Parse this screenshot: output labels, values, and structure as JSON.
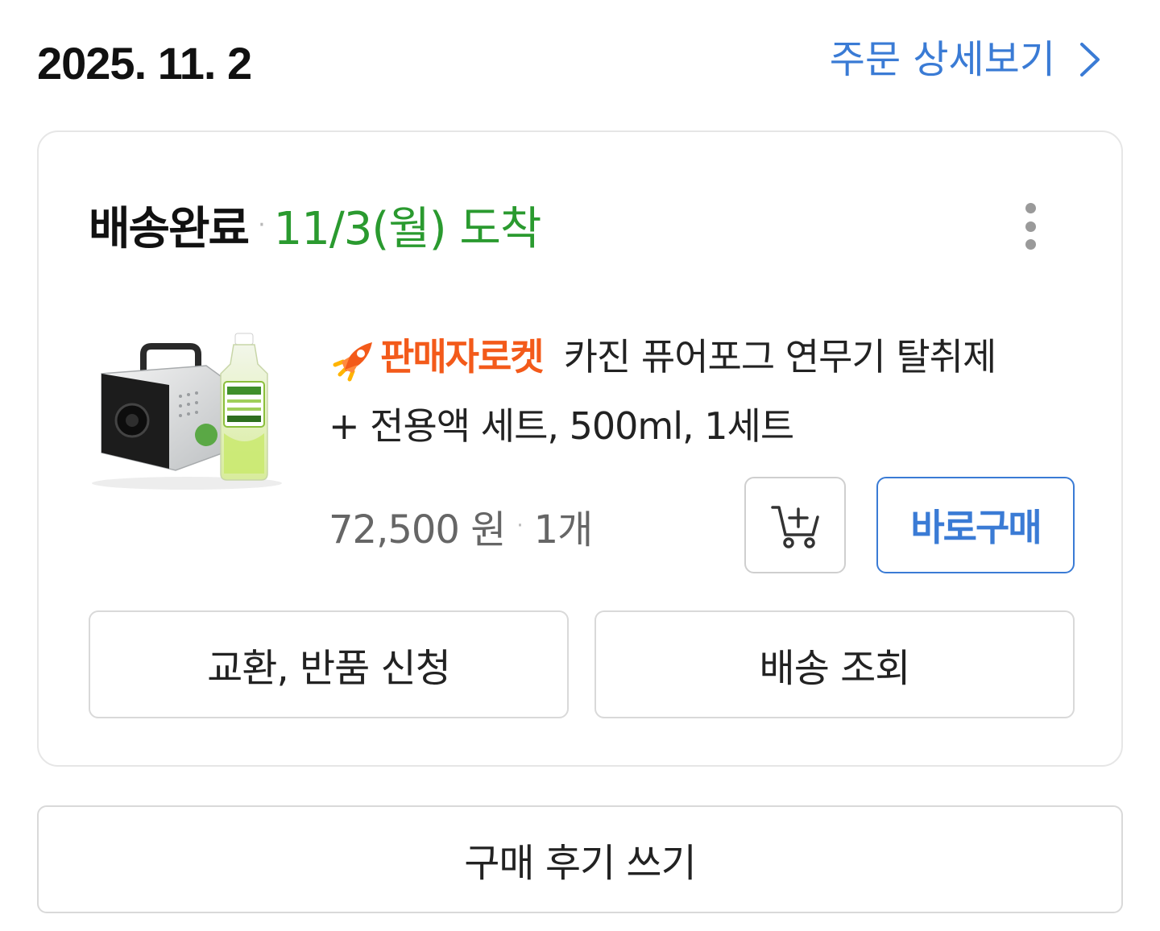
{
  "header": {
    "order_date": "2025. 11. 2",
    "detail_link_label": "주문 상세보기"
  },
  "order": {
    "status": "배송완료",
    "arrival": "11/3(월) 도착",
    "badge": "판매자로켓",
    "product_name_line1": "카진 퓨어포그 연무기 탈취제",
    "product_name_line2": "+ 전용액 세트, 500ml, 1세트",
    "price": "72,500 원",
    "quantity": "1개",
    "buy_now_label": "바로구매",
    "exchange_return_label": "교환, 반품 신청",
    "tracking_label": "배송 조회"
  },
  "footer": {
    "write_review_label": "구매 후기 쓰기"
  },
  "colors": {
    "accent_blue": "#3a7bd5",
    "arrival_green": "#2a9a2f",
    "badge_orange": "#f35a1a"
  },
  "icons": {
    "detail_link": "chevron-right-icon",
    "more": "more-vertical-icon",
    "badge": "rocket-icon",
    "cart": "cart-plus-icon"
  }
}
